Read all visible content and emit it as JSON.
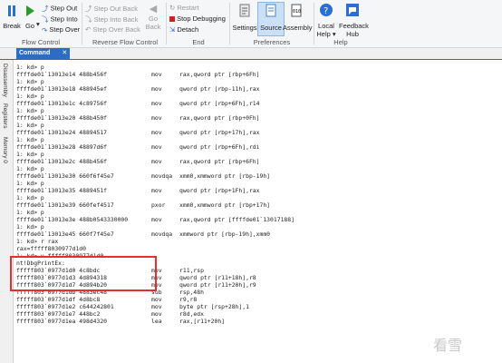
{
  "ribbon": {
    "break": "Break",
    "go": "Go",
    "step_out": "Step Out",
    "step_into": "Step Into",
    "step_over": "Step Over",
    "step_out_back": "Step Out Back",
    "step_into_back": "Step Into Back",
    "step_over_back": "Step Over Back",
    "go_back_1": "Go",
    "go_back_2": "Back",
    "restart": "Restart",
    "stop_debugging": "Stop Debugging",
    "detach": "Detach",
    "settings": "Settings",
    "source": "Source",
    "assembly": "Assembly",
    "local_help_1": "Local",
    "local_help_2": "Help ▾",
    "feedback_1": "Feedback",
    "feedback_2": "Hub",
    "groups": {
      "flow": "Flow Control",
      "reverse": "Reverse Flow Control",
      "end": "End",
      "prefs": "Preferences",
      "help": "Help"
    }
  },
  "tab": {
    "label": "Command",
    "close": "✕"
  },
  "side_tabs": [
    "Disassembly",
    "Registers",
    "Memory 0"
  ],
  "lines": [
    {
      "a": "1: kd> p"
    },
    {
      "a": "ffffde01`13013e14 488b456f",
      "m": "mov",
      "o": "rax,qword ptr [rbp+6Fh]"
    },
    {
      "a": "1: kd> p"
    },
    {
      "a": "ffffde01`13013e18 488945ef",
      "m": "mov",
      "o": "qword ptr [rbp-11h],rax"
    },
    {
      "a": "1: kd> p"
    },
    {
      "a": "ffffde01`13013e1c 4c89756f",
      "m": "mov",
      "o": "qword ptr [rbp+6Fh],r14"
    },
    {
      "a": "1: kd> p"
    },
    {
      "a": "ffffde01`13013e20 488b450f",
      "m": "mov",
      "o": "rax,qword ptr [rbp+0Fh]"
    },
    {
      "a": "1: kd> p"
    },
    {
      "a": "ffffde01`13013e24 48894517",
      "m": "mov",
      "o": "qword ptr [rbp+17h],rax"
    },
    {
      "a": "1: kd> p"
    },
    {
      "a": "ffffde01`13013e28 48897d6f",
      "m": "mov",
      "o": "qword ptr [rbp+6Fh],rdi"
    },
    {
      "a": "1: kd> p"
    },
    {
      "a": "ffffde01`13013e2c 488b456f",
      "m": "mov",
      "o": "rax,qword ptr [rbp+6Fh]"
    },
    {
      "a": "1: kd> p"
    },
    {
      "a": "ffffde01`13013e30 660f6f45e7",
      "m": "movdqa",
      "o": "xmm0,xmmword ptr [rbp-19h]"
    },
    {
      "a": "1: kd> p"
    },
    {
      "a": "ffffde01`13013e35 4889451f",
      "m": "mov",
      "o": "qword ptr [rbp+1Fh],rax"
    },
    {
      "a": "1: kd> p"
    },
    {
      "a": "ffffde01`13013e39 660fef4517",
      "m": "pxor",
      "o": "xmm0,xmmword ptr [rbp+17h]"
    },
    {
      "a": "1: kd> p"
    },
    {
      "a": "ffffde01`13013e3e 488b0543330000",
      "m": "mov",
      "o": "rax,qword ptr [ffffde01`13017188]"
    },
    {
      "a": "1: kd> p"
    },
    {
      "a": "ffffde01`13013e45 660f7f45e7",
      "m": "movdqa",
      "o": "xmmword ptr [rbp-19h],xmm0"
    },
    {
      "a": "1: kd> r rax"
    },
    {
      "a": "rax=fffff8030977d1d0"
    },
    {
      "a": "1: kd> u fffff8030977d1d0"
    },
    {
      "a": "nt!DbgPrintEx:"
    },
    {
      "a": "fffff803`0977d1d0 4c8bdc",
      "m": "mov",
      "o": "r11,rsp"
    },
    {
      "a": "fffff803`0977d1d3 4d894318",
      "m": "mov",
      "o": "qword ptr [r11+18h],r8"
    },
    {
      "a": "fffff803`0977d1d7 4d894b20",
      "m": "mov",
      "o": "qword ptr [r11+20h],r9"
    },
    {
      "a": "fffff803`0977d1db 4883ec48",
      "m": "sub",
      "o": "rsp,48h"
    },
    {
      "a": "fffff803`0977d1df 4d8bc8",
      "m": "mov",
      "o": "r9,r8"
    },
    {
      "a": "fffff803`0977d1e2 c644242801",
      "m": "mov",
      "o": "byte ptr [rsp+28h],1"
    },
    {
      "a": "fffff803`0977d1e7 448bc2",
      "m": "mov",
      "o": "r8d,edx"
    },
    {
      "a": "fffff803`0977d1ea 498d4320",
      "m": "lea",
      "o": "rax,[r11+20h]"
    }
  ],
  "watermark": "看雪"
}
